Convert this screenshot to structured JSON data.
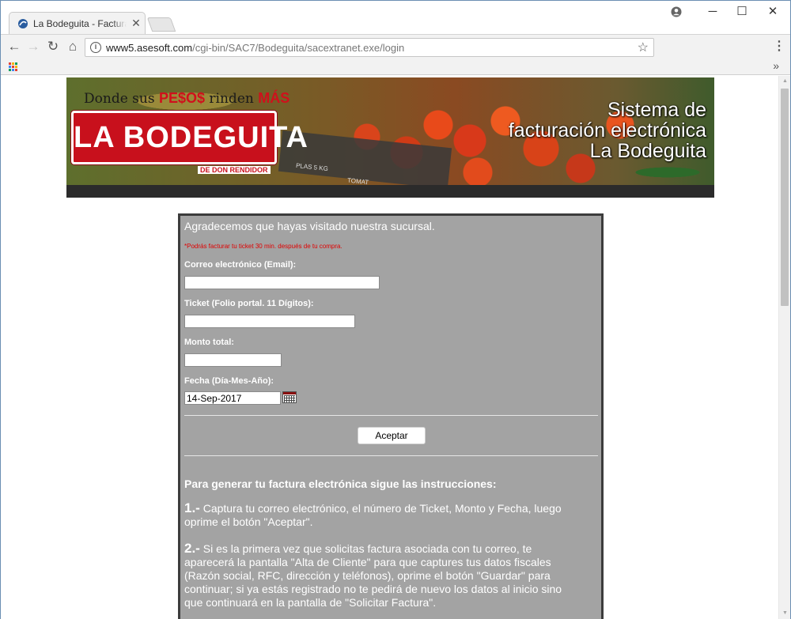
{
  "browser": {
    "tab_title": "La Bodeguita - Facturación",
    "url_host": "www5.asesoft.com",
    "url_path": "/cgi-bin/SAC7/Bodeguita/sacextranet.exe/login"
  },
  "banner": {
    "slogan_prefix": "Donde sus ",
    "slogan_highlight": "PE$O$",
    "slogan_mid": " rinden ",
    "slogan_emph": "MÁS",
    "logo_text": "LA BODEGUITA",
    "logo_sub": "DE DON RENDIDOR",
    "headline_1": "Sistema de",
    "headline_2": "facturación electrónica",
    "headline_3": "La Bodeguita",
    "crate_label_1": "PLAS 5 KG",
    "crate_label_2": "TOMAT"
  },
  "form": {
    "greeting": "Agradecemos que hayas visitado nuestra sucursal.",
    "note": "*Podrás facturar tu ticket 30 min. después de tu compra.",
    "email_label": "Correo electrónico (Email):",
    "email_value": "",
    "ticket_label": "Ticket (Folio portal. 11 Dígitos):",
    "ticket_value": "",
    "amount_label": "Monto total:",
    "amount_value": "",
    "date_label": "Fecha (Día-Mes-Año):",
    "date_value": "14-Sep-2017",
    "submit_label": "Aceptar"
  },
  "instructions": {
    "title": "Para generar tu factura electrónica sigue las instrucciones:",
    "steps": [
      {
        "num": "1.-",
        "text": " Captura tu correo electrónico, el número de Ticket, Monto y Fecha, luego oprime el botón \"Aceptar\"."
      },
      {
        "num": "2.-",
        "text": " Si es la primera vez que solicitas factura asociada con tu correo, te aparecerá la pantalla \"Alta de Cliente\" para que captures tus datos fiscales (Razón social, RFC, dirección y teléfonos), oprime el botón \"Guardar\" para continuar; si ya estás registrado no te pedirá de nuevo los datos al inicio sino que continuará en la pantalla de \"Solicitar Factura\"."
      }
    ]
  },
  "colors": {
    "panel_bg": "#a3a3a3",
    "brand_red": "#c8101c",
    "note_red": "#e00000"
  }
}
